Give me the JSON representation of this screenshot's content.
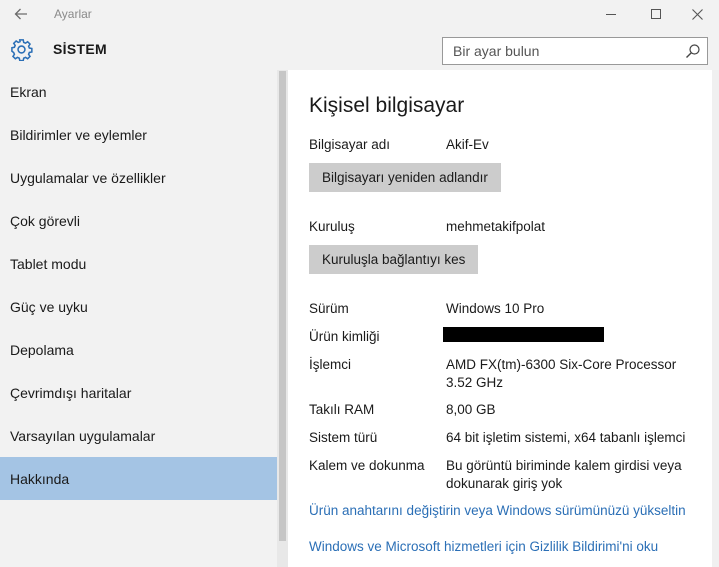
{
  "window": {
    "app_title": "Ayarlar",
    "icons": [
      "back-arrow",
      "minimize",
      "maximize",
      "close"
    ]
  },
  "header": {
    "section_title": "SİSTEM",
    "search_placeholder": "Bir ayar bulun",
    "search_value": ""
  },
  "sidebar": {
    "items": [
      {
        "label": "Ekran",
        "active": false
      },
      {
        "label": "Bildirimler ve eylemler",
        "active": false
      },
      {
        "label": "Uygulamalar ve özellikler",
        "active": false
      },
      {
        "label": "Çok görevli",
        "active": false
      },
      {
        "label": "Tablet modu",
        "active": false
      },
      {
        "label": "Güç ve uyku",
        "active": false
      },
      {
        "label": "Depolama",
        "active": false
      },
      {
        "label": "Çevrimdışı haritalar",
        "active": false
      },
      {
        "label": "Varsayılan uygulamalar",
        "active": false
      },
      {
        "label": "Hakkında",
        "active": true
      }
    ]
  },
  "main": {
    "heading": "Kişisel bilgisayar",
    "pc_name_label": "Bilgisayar adı",
    "pc_name_value": "Akif-Ev",
    "rename_button": "Bilgisayarı yeniden adlandır",
    "org_label": "Kuruluş",
    "org_value": "mehmetakifpolat",
    "disconnect_button": "Kuruluşla bağlantıyı kes",
    "specs": {
      "edition_label": "Sürüm",
      "edition_value": "Windows 10 Pro",
      "product_id_label": "Ürün kimliği",
      "processor_label": "İşlemci",
      "processor_line1": "AMD FX(tm)-6300 Six-Core Processor",
      "processor_line2": "3.52 GHz",
      "ram_label": "Takılı RAM",
      "ram_value": "8,00 GB",
      "system_type_label": "Sistem türü",
      "system_type_value": "64 bit işletim sistemi, x64 tabanlı işlemci",
      "pen_label": "Kalem ve dokunma",
      "pen_line1": "Bu görüntü biriminde kalem girdisi veya",
      "pen_line2": "dokunarak giriş yok"
    },
    "links": {
      "upgrade": "Ürün anahtarını değiştirin veya Windows sürümünüzü yükseltin",
      "privacy": "Windows ve Microsoft hizmetleri için Gizlilik Bildirimi'ni oku"
    }
  },
  "colors": {
    "accent": "#2b6fb6",
    "active_item": "#a4c4e4",
    "button": "#cccccc",
    "sidebar_bg": "#f2f2f2"
  }
}
